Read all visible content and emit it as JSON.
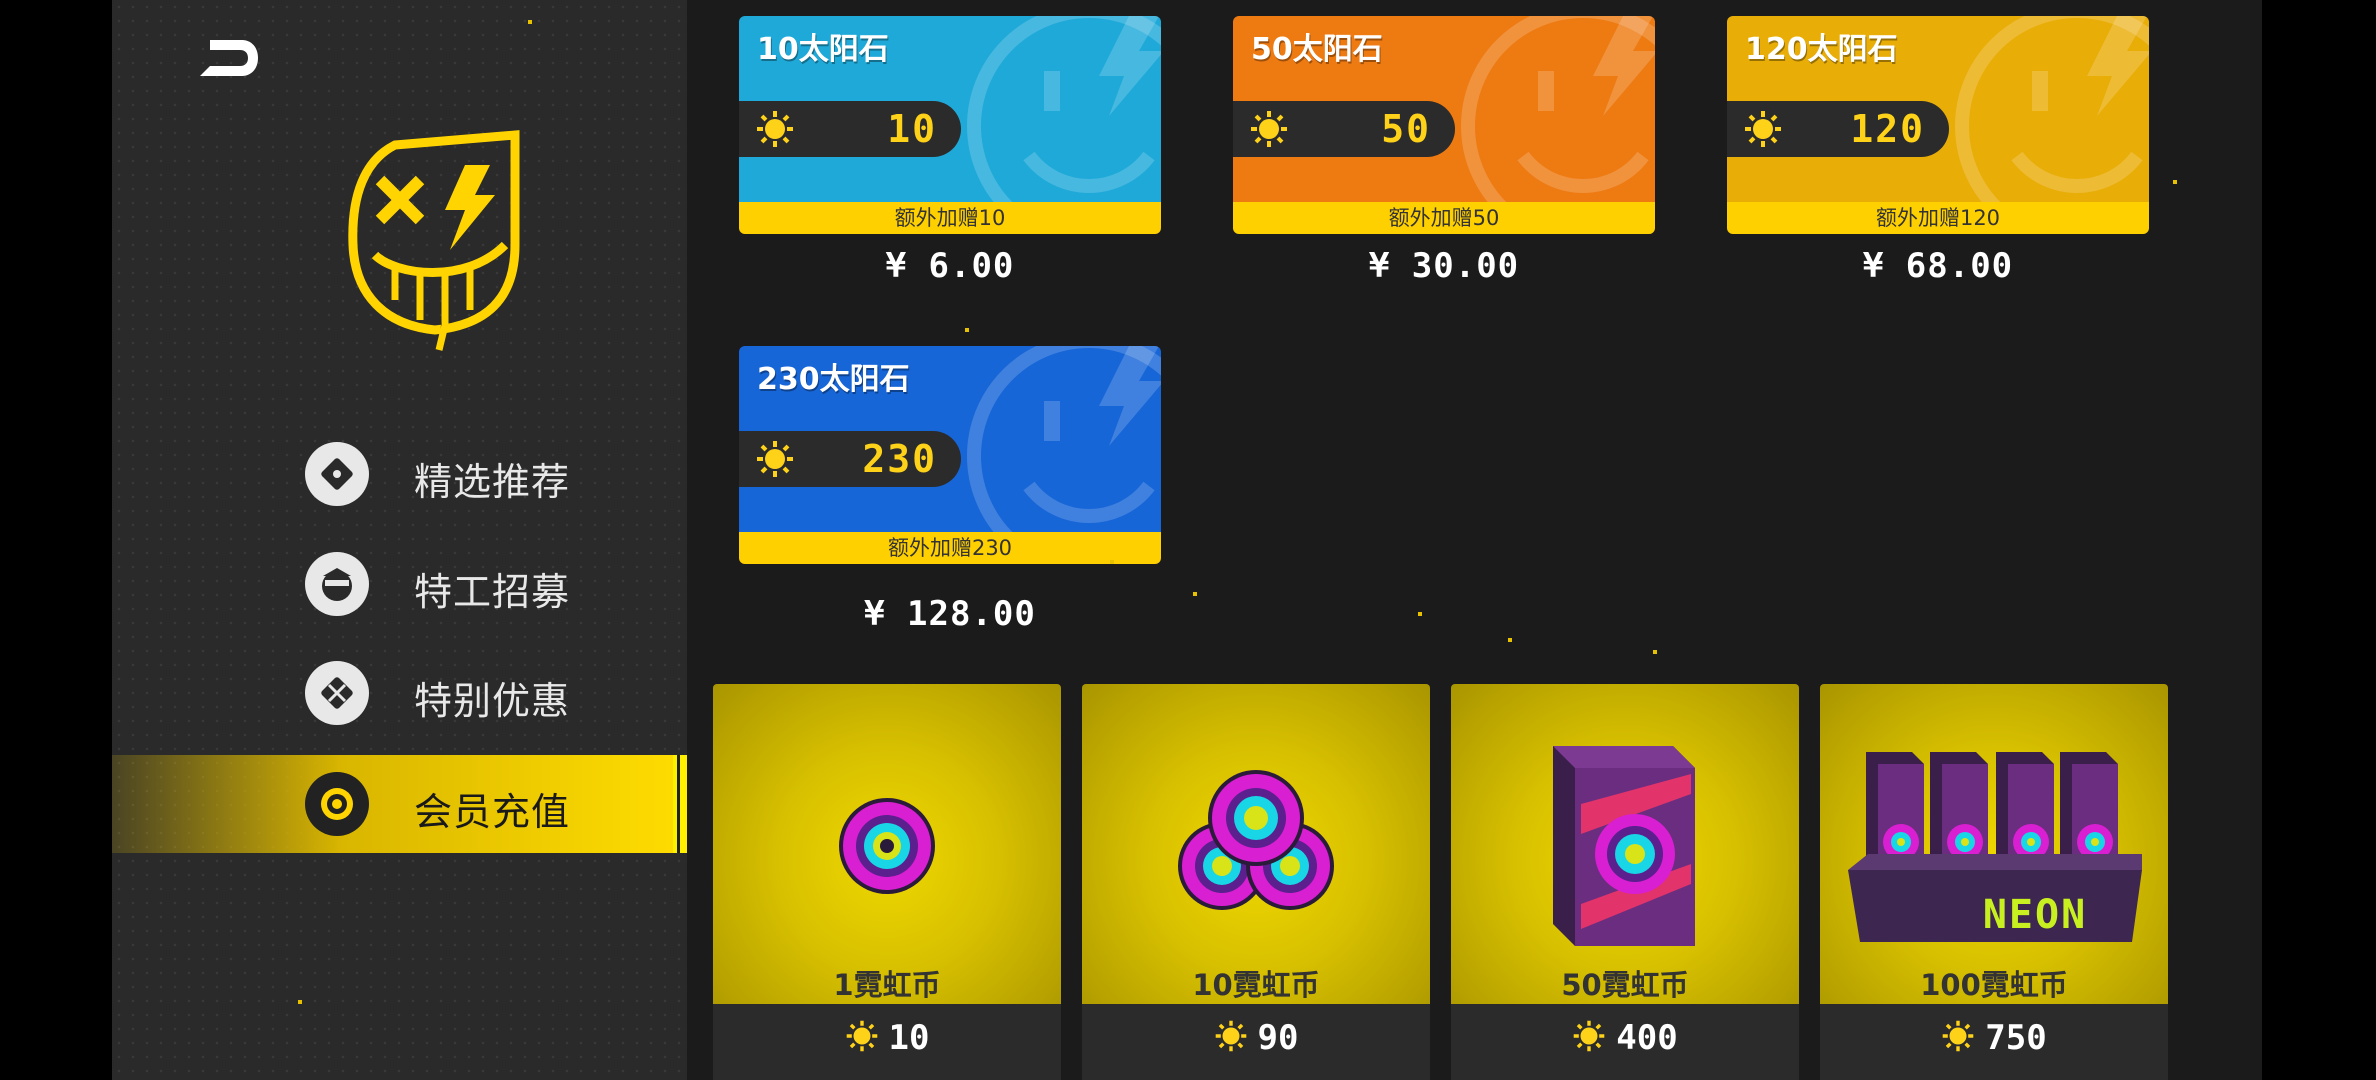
{
  "sidebar": {
    "items": [
      {
        "label": "精选推荐",
        "icon": "ticket-icon",
        "active": false
      },
      {
        "label": "特工招募",
        "icon": "agent-face-icon",
        "active": false
      },
      {
        "label": "特别优惠",
        "icon": "ticket-cross-icon",
        "active": false
      },
      {
        "label": "会员充值",
        "icon": "coin-target-icon",
        "active": true
      }
    ]
  },
  "sunstone_packs": [
    {
      "title": "10太阳石",
      "amount": "10",
      "bonus": "额外加赠10",
      "price": "¥ 6.00",
      "color": "#1fa9d8"
    },
    {
      "title": "50太阳石",
      "amount": "50",
      "bonus": "额外加赠50",
      "price": "¥ 30.00",
      "color": "#ee7a12"
    },
    {
      "title": "120太阳石",
      "amount": "120",
      "bonus": "额外加赠120",
      "price": "¥ 68.00",
      "color": "#e9ad08"
    },
    {
      "title": "230太阳石",
      "amount": "230",
      "bonus": "额外加赠230",
      "price": "¥ 128.00",
      "color": "#1766d8"
    }
  ],
  "neon_packs": [
    {
      "name": "1霓虹币",
      "cost": "10"
    },
    {
      "name": "10霓虹币",
      "cost": "90"
    },
    {
      "name": "50霓虹币",
      "cost": "400"
    },
    {
      "name": "100霓虹币",
      "cost": "750",
      "box_label": "NEON"
    }
  ],
  "colors": {
    "accent": "#ffdd00",
    "sidebar_bg": "#2a2a2a",
    "main_bg": "#1b1b1b"
  }
}
